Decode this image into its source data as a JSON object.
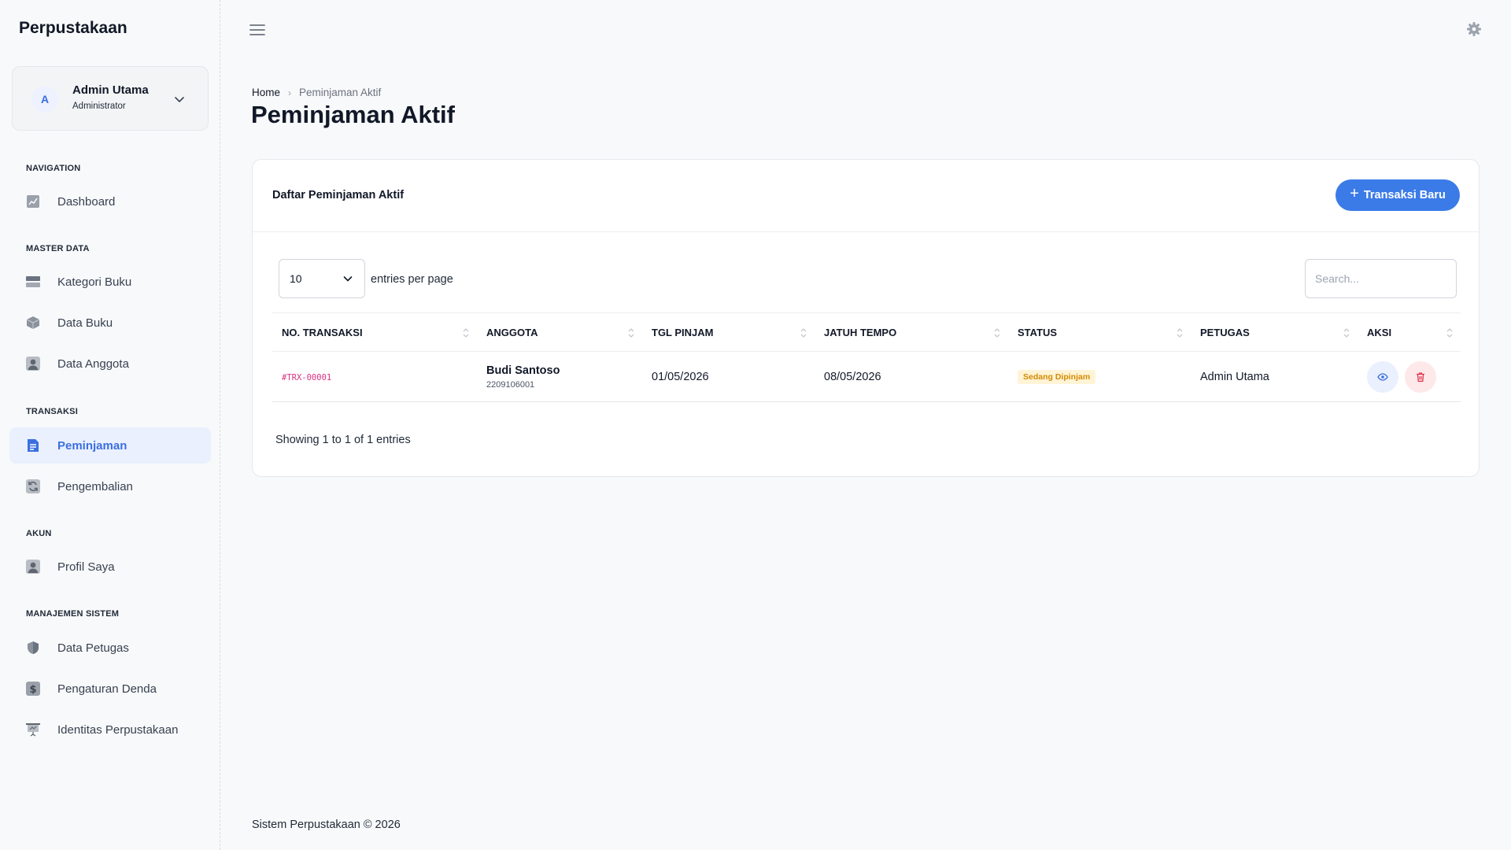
{
  "sidebar": {
    "brand": "Perpustakaan",
    "user": {
      "initial": "A",
      "name": "Admin Utama",
      "role": "Administrator"
    },
    "sections": [
      {
        "heading": "NAVIGATION",
        "items": [
          {
            "label": "Dashboard",
            "icon": "chart-icon"
          }
        ]
      },
      {
        "heading": "MASTER DATA",
        "items": [
          {
            "label": "Kategori Buku",
            "icon": "category-icon"
          },
          {
            "label": "Data Buku",
            "icon": "box-icon"
          },
          {
            "label": "Data Anggota",
            "icon": "user-icon"
          }
        ]
      },
      {
        "heading": "TRANSAKSI",
        "items": [
          {
            "label": "Peminjaman",
            "icon": "document-icon",
            "active": true
          },
          {
            "label": "Pengembalian",
            "icon": "refresh-icon"
          }
        ]
      },
      {
        "heading": "AKUN",
        "items": [
          {
            "label": "Profil Saya",
            "icon": "user-icon"
          }
        ]
      },
      {
        "heading": "MANAJEMEN SISTEM",
        "items": [
          {
            "label": "Data Petugas",
            "icon": "shield-icon"
          },
          {
            "label": "Pengaturan Denda",
            "icon": "dollar-icon"
          },
          {
            "label": "Identitas Perpustakaan",
            "icon": "presentation-icon"
          }
        ]
      }
    ]
  },
  "breadcrumb": {
    "home": "Home",
    "separator": "›",
    "current": "Peminjaman Aktif"
  },
  "page_title": "Peminjaman Aktif",
  "card": {
    "title": "Daftar Peminjaman Aktif",
    "new_button": {
      "icon": "+",
      "label": "Transaksi Baru"
    },
    "per_page": {
      "value": "10",
      "label": "entries per page"
    },
    "search_placeholder": "Search...",
    "columns": [
      "No. Transaksi",
      "Anggota",
      "Tgl Pinjam",
      "Jatuh Tempo",
      "Status",
      "Petugas",
      "Aksi"
    ],
    "rows": [
      {
        "id": "#TRX-00001",
        "member_name": "Budi Santoso",
        "member_id": "2209106001",
        "loan_date": "01/05/2026",
        "due_date": "08/05/2026",
        "status": "Sedang Dipinjam",
        "officer": "Admin Utama"
      }
    ],
    "showing": "Showing 1 to 1 of 1 entries"
  },
  "footer": "Sistem Perpustakaan © 2026",
  "colors": {
    "accent": "#3b7be8",
    "active_bg": "#eaf0fd",
    "badge_bg": "#fff4d6",
    "badge_text": "#d48a00",
    "trx_text": "#d63384",
    "danger": "#e0354a"
  }
}
